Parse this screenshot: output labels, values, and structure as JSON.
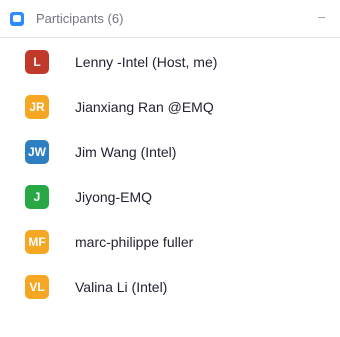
{
  "header": {
    "title": "Participants (6)",
    "minimize": "–"
  },
  "participants": [
    {
      "initials": "L",
      "name": "Lenny -Intel (Host, me)",
      "color": "#c0392b"
    },
    {
      "initials": "JR",
      "name": "Jianxiang Ran @EMQ",
      "color": "#f5a623"
    },
    {
      "initials": "JW",
      "name": "Jim Wang (Intel)",
      "color": "#2e7fc1"
    },
    {
      "initials": "J",
      "name": "Jiyong-EMQ",
      "color": "#28a745"
    },
    {
      "initials": "MF",
      "name": "marc-philippe fuller",
      "color": "#f5a623"
    },
    {
      "initials": "VL",
      "name": "Valina Li (Intel)",
      "color": "#f5a623"
    }
  ]
}
